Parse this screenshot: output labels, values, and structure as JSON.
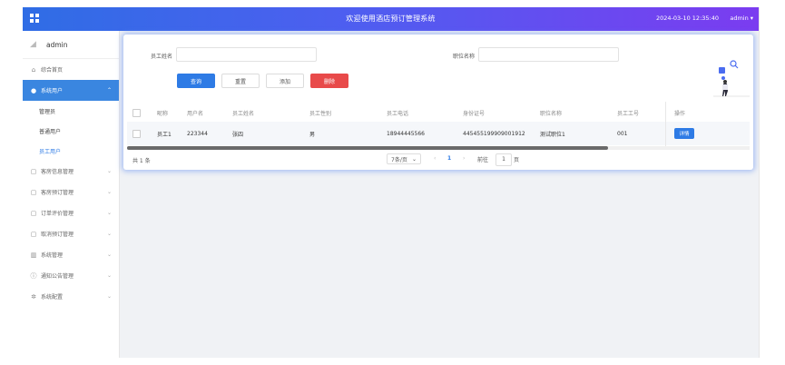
{
  "header": {
    "title": "欢迎使用酒店预订管理系统",
    "datetime": "2024-03-10 12:35:40",
    "user": "admin"
  },
  "sidebar": {
    "username": "admin",
    "items": [
      {
        "label": "综合首页",
        "icon": "home-icon"
      },
      {
        "label": "系统用户",
        "icon": "user-icon",
        "children": [
          "管理员",
          "普通用户",
          "员工用户"
        ]
      },
      {
        "label": "客房信息管理",
        "icon": "doc-icon"
      },
      {
        "label": "客房预订管理",
        "icon": "doc-icon"
      },
      {
        "label": "订单评价管理",
        "icon": "doc-icon"
      },
      {
        "label": "取消预订管理",
        "icon": "doc-icon"
      },
      {
        "label": "系统管理",
        "icon": "chart-icon"
      },
      {
        "label": "通知公告管理",
        "icon": "info-icon"
      },
      {
        "label": "系统配置",
        "icon": "gear-icon"
      }
    ]
  },
  "search": {
    "name_label": "员工姓名",
    "name_value": "",
    "position_label": "职位名称",
    "position_value": ""
  },
  "buttons": {
    "query": "查询",
    "reset": "重置",
    "add": "添加",
    "delete": "删除"
  },
  "table": {
    "columns": [
      "昵称",
      "用户名",
      "员工姓名",
      "员工性别",
      "员工电话",
      "身份证号",
      "职位名称",
      "员工工号",
      "操作"
    ],
    "rows": [
      {
        "nickname": "员工1",
        "username": "223344",
        "name": "张四",
        "gender": "男",
        "phone": "18944445566",
        "id_card": "445455199909001912",
        "position": "测试职位1",
        "emp_no": "001",
        "action": "详情"
      }
    ]
  },
  "pager": {
    "total": "共 1 条",
    "page_size": "7条/页",
    "current": "1",
    "goto": "前往",
    "goto_value": "1",
    "unit": "页"
  },
  "colors": {
    "primary": "#2e7be5",
    "danger": "#e84a4a"
  }
}
